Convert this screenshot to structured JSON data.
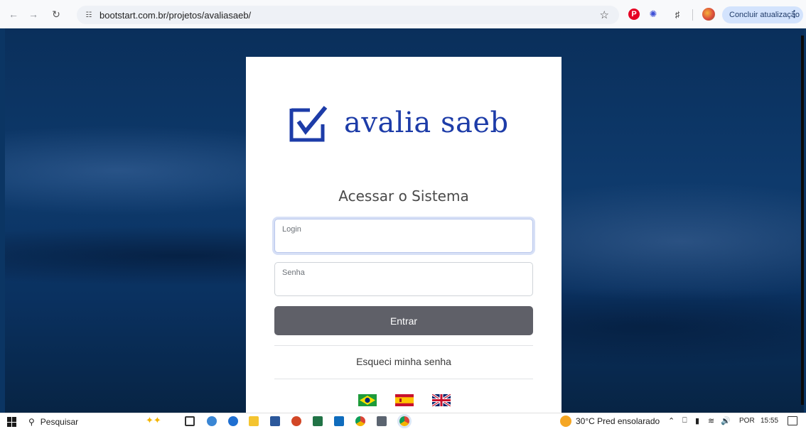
{
  "browser": {
    "url": "bootstart.com.br/projetos/avaliasaeb/",
    "update_button": "Concluir atualização"
  },
  "login_card": {
    "logo_text": "avalia saeb",
    "heading": "Acessar o Sistema",
    "login_label": "Login",
    "password_label": "Senha",
    "submit_label": "Entrar",
    "forgot_password": "Esqueci minha senha",
    "languages": [
      "Português",
      "Español",
      "English"
    ]
  },
  "taskbar": {
    "search_label": "Pesquisar",
    "weather": "30°C  Pred ensolarado",
    "language": "POR",
    "time": "15:55"
  },
  "colors": {
    "brand_blue": "#1d3ca8",
    "button_gray": "#5f6068",
    "background_navy": "#0b3563"
  }
}
